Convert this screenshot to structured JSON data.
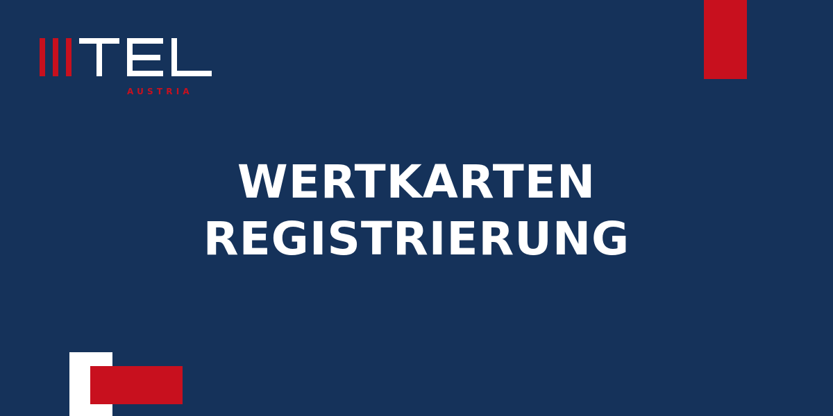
{
  "brand": {
    "name": "TEL",
    "subtitle": "AUSTRIA"
  },
  "headline": {
    "line1": "WERTKARTEN",
    "line2": "REGISTRIERUNG"
  },
  "colors": {
    "background": "#15325a",
    "accent_red": "#c8101e",
    "white": "#ffffff"
  },
  "icons": [
    "brand-logo-icon",
    "decorative-blocks"
  ]
}
